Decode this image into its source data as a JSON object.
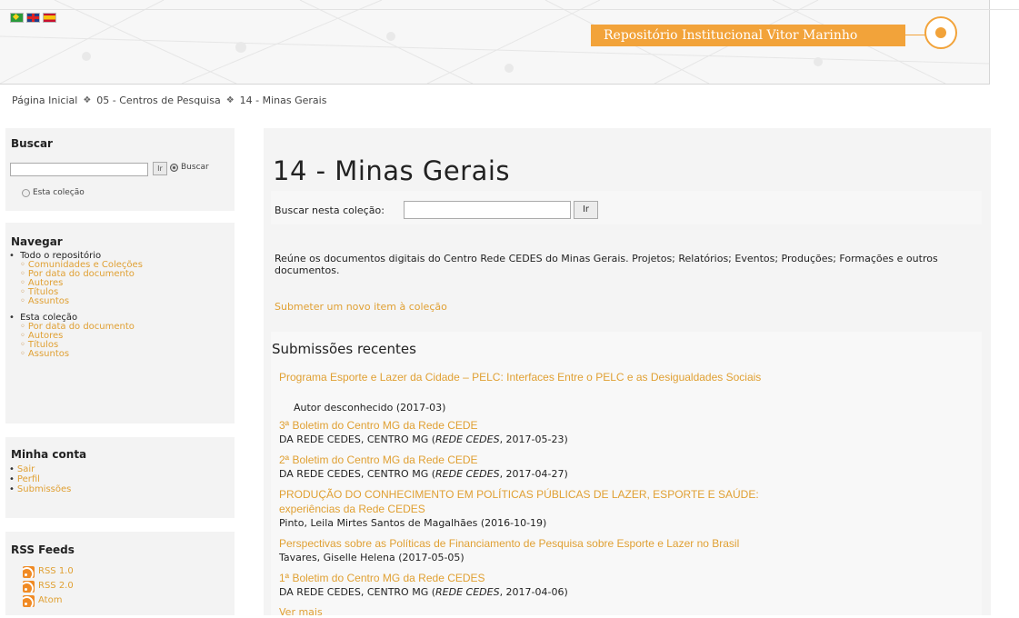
{
  "header": {
    "repo_name": "Repositório Institucional Vitor Marinho",
    "flags": [
      "brazil-flag-icon",
      "uk-flag-icon",
      "spain-flag-icon"
    ],
    "accent_color": "#f2a33a"
  },
  "breadcrumb": {
    "items": [
      "Página Inicial",
      "05 - Centros de Pesquisa",
      "14 - Minas Gerais"
    ],
    "separator": "❖"
  },
  "sidebar": {
    "search": {
      "heading": "Buscar",
      "go_label": "Ir",
      "option_all": "Buscar",
      "option_collection": "Esta coleção"
    },
    "navigate": {
      "heading": "Navegar",
      "groups": [
        {
          "label": "Todo o repositório",
          "links": [
            "Comunidades e Coleções",
            "Por data do documento",
            "Autores",
            "Títulos",
            "Assuntos"
          ]
        },
        {
          "label": "Esta coleção",
          "links": [
            "Por data do documento",
            "Autores",
            "Títulos",
            "Assuntos"
          ]
        }
      ]
    },
    "account": {
      "heading": "Minha conta",
      "links": [
        "Sair",
        "Perfil",
        "Submissões"
      ]
    },
    "rss": {
      "heading": "RSS Feeds",
      "feeds": [
        "RSS 1.0",
        "RSS 2.0",
        "Atom"
      ]
    }
  },
  "main": {
    "title": "14 - Minas Gerais",
    "collection_search_label": "Buscar nesta coleção:",
    "collection_search_button": "Ir",
    "description": "Reúne os documentos digitais do Centro Rede CEDES do Minas Gerais. Projetos; Relatórios; Eventos; Produções; Formações e outros documentos.",
    "submit_link": "Submeter um novo item à coleção",
    "recent_heading": "Submissões recentes",
    "items": [
      {
        "title": "Programa Esporte e Lazer da Cidade – PELC: Interfaces Entre o PELC e as Desigualdades Sociais",
        "meta": "Autor desconhecido (2017-03)"
      },
      {
        "title": "3ª Boletim do Centro MG da Rede CEDE",
        "meta_author": "DA REDE CEDES, CENTRO MG (",
        "meta_pub": "REDE CEDES",
        "meta_date": ", 2017-05-23)"
      },
      {
        "title": "2ª Boletim do Centro MG da Rede CEDE",
        "meta_author": "DA REDE CEDES, CENTRO MG (",
        "meta_pub": "REDE CEDES",
        "meta_date": ", 2017-04-27)"
      },
      {
        "title_line1": "PRODUÇÃO DO CONHECIMENTO EM POLÍTICAS PÚBLICAS DE LAZER, ESPORTE E SAÚDE:",
        "title_line2": "experiências da Rede CEDES",
        "meta": "Pinto, Leila Mirtes Santos de Magalhães (2016-10-19)"
      },
      {
        "title": "Perspectivas sobre as Políticas de Financiamento de Pesquisa sobre Esporte e Lazer no Brasil",
        "meta": "Tavares, Giselle Helena (2017-05-05)"
      },
      {
        "title": "1ª Boletim do Centro MG da Rede CEDES",
        "meta_author": "DA REDE CEDES, CENTRO MG (",
        "meta_pub": "REDE CEDES",
        "meta_date": ", 2017-04-06)"
      }
    ],
    "more_link": "Ver mais"
  }
}
